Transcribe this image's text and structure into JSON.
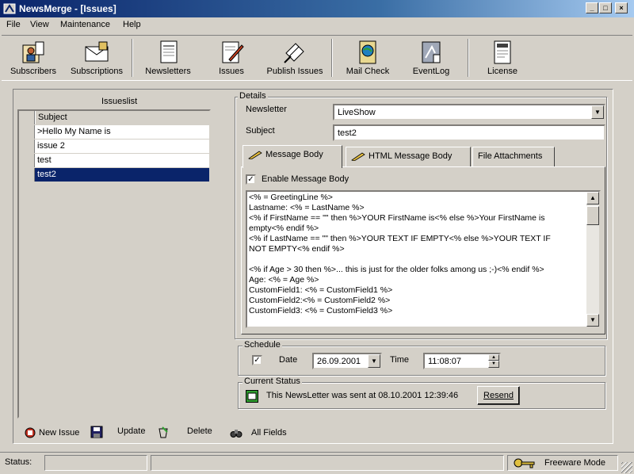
{
  "window": {
    "title": "NewsMerge - [Issues]"
  },
  "menu": [
    "File",
    "View",
    "Maintenance",
    "Help"
  ],
  "toolbar": [
    {
      "label": "Subscribers",
      "icon": "subscribers-icon"
    },
    {
      "label": "Subscriptions",
      "icon": "subscriptions-icon"
    },
    {
      "label": "Newsletters",
      "icon": "newsletters-icon"
    },
    {
      "label": "Issues",
      "icon": "issues-icon"
    },
    {
      "label": "Publish Issues",
      "icon": "publish-issues-icon"
    },
    {
      "label": "Mail Check",
      "icon": "mail-check-icon"
    },
    {
      "label": "EventLog",
      "icon": "event-log-icon"
    },
    {
      "label": "License",
      "icon": "license-icon"
    }
  ],
  "issues": {
    "label": "Issueslist",
    "header": "Subject",
    "rows": [
      ">Hello My Name is",
      "issue 2",
      "test",
      "test2"
    ],
    "selected_index": 3
  },
  "details": {
    "label": "Details",
    "newsletter_label": "Newsletter",
    "newsletter_value": "LiveShow",
    "subject_label": "Subject",
    "subject_value": "test2",
    "tabs": [
      "Message Body",
      "HTML Message Body",
      "File Attachments"
    ],
    "active_tab": 0,
    "enable_label": "Enable Message Body",
    "enable_checked": true,
    "body_lines": [
      "<% = GreetingLine %>",
      "Lastname: <% = LastName %>",
      "<% if FirstName == \"\" then %>YOUR FirstName is<% else %>Your FirstName is",
      "empty<% endif %>",
      "<% if LastName == \"\" then %>YOUR TEXT IF EMPTY<% else %>YOUR TEXT IF",
      "NOT EMPTY<% endif %>",
      "",
      "<% if Age > 30 then %>... this is just for the older folks among us ;-)<% endif %>",
      "Age: <% = Age %>",
      "CustomField1: <% = CustomField1 %>",
      "CustomField2:<% = CustomField2 %>",
      "CustomField3: <% = CustomField3 %>"
    ]
  },
  "schedule": {
    "label": "Schedule",
    "date_label": "Date",
    "date_value": "26.09.2001",
    "date_checked": true,
    "time_label": "Time",
    "time_value": "11:08:07"
  },
  "current_status": {
    "label": "Current Status",
    "text": "This NewsLetter was sent at 08.10.2001 12:39:46",
    "resend_label": "Resend"
  },
  "actions": [
    "New Issue",
    "Update",
    "Delete",
    "All Fields"
  ],
  "statusbar": {
    "status_label": "Status:",
    "mode": "Freeware Mode"
  }
}
